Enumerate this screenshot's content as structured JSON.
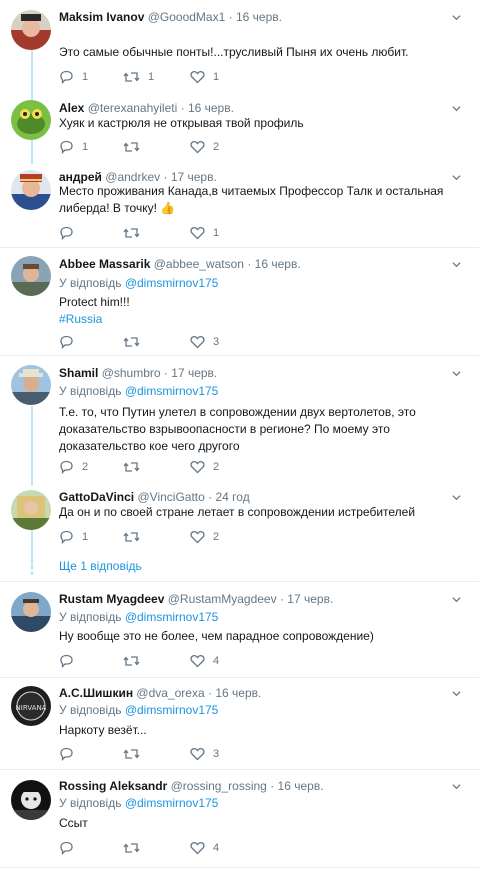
{
  "icons": {
    "reply": "reply-icon",
    "retweet": "retweet-icon",
    "like": "heart-icon",
    "menu": "chevron-down-icon"
  },
  "colors": {
    "link": "#1b95e0",
    "muted": "#657786",
    "thread": "#c4e3f7",
    "separator": "#e6ecf0"
  },
  "tweets": [
    {
      "name": "Maksim Ivanov",
      "handle": "@GooodMax1",
      "dot": "·",
      "date": "16 черв.",
      "reply_prefix": "",
      "reply_to": "",
      "text": "Это самые обычные понты!...трусливый Пыня их очень любит.",
      "hashtag": "",
      "replies": "1",
      "retweets": "1",
      "likes": "1"
    },
    {
      "name": "Alex",
      "handle": "@terexanahyileti",
      "dot": "·",
      "date": "16 черв.",
      "reply_prefix": "",
      "reply_to": "",
      "text": "Хуяк и кастрюля не открывая твой профиль",
      "hashtag": "",
      "replies": "1",
      "retweets": "",
      "likes": "2"
    },
    {
      "name": "андрей",
      "handle": "@andrkev",
      "dot": "·",
      "date": "17 черв.",
      "reply_prefix": "",
      "reply_to": "",
      "text": "Место проживания Канада,в читаемых Профессор Талк и остальная либерда! В точку! 👍",
      "hashtag": "",
      "replies": "",
      "retweets": "",
      "likes": "1"
    },
    {
      "name": "Abbee Massarik",
      "handle": "@abbee_watson",
      "dot": "·",
      "date": "16 черв.",
      "reply_prefix": "У відповідь",
      "reply_to": "@dimsmirnov175",
      "text": "Protect him!!!",
      "hashtag": "#Russia",
      "replies": "",
      "retweets": "",
      "likes": "3"
    },
    {
      "name": "Shamil",
      "handle": "@shumbro",
      "dot": "·",
      "date": "17 черв.",
      "reply_prefix": "У відповідь",
      "reply_to": "@dimsmirnov175",
      "text": "Т.е. то, что Путин улетел в сопровождении двух вертолетов, это доказательство взрывоопасности в регионе? По моему это доказательство кое чего другого",
      "hashtag": "",
      "replies": "2",
      "retweets": "",
      "likes": "2"
    },
    {
      "name": "GattoDaVinci",
      "handle": "@VinciGatto",
      "dot": "·",
      "date": "24 год",
      "reply_prefix": "",
      "reply_to": "",
      "text": "Да он и по своей стране летает в сопровождении истребителей",
      "hashtag": "",
      "replies": "1",
      "retweets": "",
      "likes": "2"
    },
    {
      "name": "Rustam Myagdeev",
      "handle": "@RustamMyagdeev",
      "dot": "·",
      "date": "17 черв.",
      "reply_prefix": "У відповідь",
      "reply_to": "@dimsmirnov175",
      "text": "Ну вообще это не более, чем парадное сопровождение)",
      "hashtag": "",
      "replies": "",
      "retweets": "",
      "likes": "4"
    },
    {
      "name": "А.С.Шишкин",
      "handle": "@dva_orexa",
      "dot": "·",
      "date": "16 черв.",
      "reply_prefix": "У відповідь",
      "reply_to": "@dimsmirnov175",
      "text": "Наркоту везёт...",
      "hashtag": "",
      "replies": "",
      "retweets": "",
      "likes": "3"
    },
    {
      "name": "Rossing Aleksandr",
      "handle": "@rossing_rossing",
      "dot": "·",
      "date": "16 черв.",
      "reply_prefix": "У відповідь",
      "reply_to": "@dimsmirnov175",
      "text": "Ссыт",
      "hashtag": "",
      "replies": "",
      "retweets": "",
      "likes": "4"
    }
  ],
  "show_more": "Ще 1 відповідь"
}
